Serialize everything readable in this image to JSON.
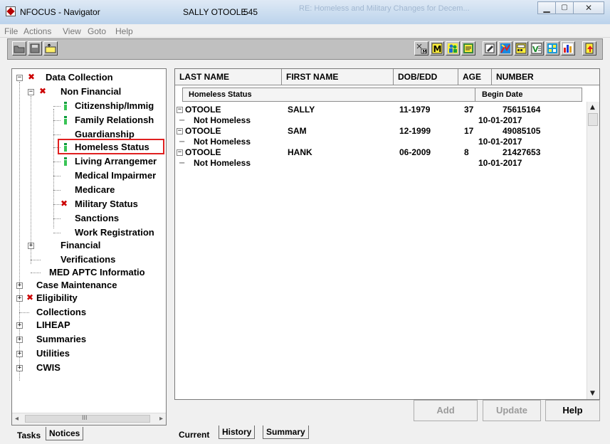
{
  "window": {
    "title": "NFOCUS - Navigator",
    "user": "SALLY OTOOLE",
    "case_number": "545",
    "faint_text": "RE: Homeless and Military Changes for Decem..."
  },
  "menu": [
    "File",
    "Actions",
    "View",
    "Goto",
    "Help"
  ],
  "toolbar": {
    "left_icons": [
      "open-folder-icon",
      "save-disk-icon",
      "new-folder-icon"
    ],
    "right_icons": [
      "case-tool-icon",
      "m-icon",
      "people-icon",
      "notes-icon",
      "edit-icon",
      "map-icon",
      "calculator-icon",
      "v-icon",
      "grid-icon",
      "bar-chart-icon",
      "exit-icon"
    ]
  },
  "tree": {
    "items": [
      {
        "label": "Data Collection",
        "level": 0,
        "expander": "minus",
        "marker": "red-x"
      },
      {
        "label": "Non Financial",
        "level": 1,
        "expander": "minus",
        "marker": "red-x"
      },
      {
        "label": "Citizenship/Immig",
        "level": 2,
        "marker": "green-i"
      },
      {
        "label": "Family Relationsh",
        "level": 2,
        "marker": "green-i"
      },
      {
        "label": "Guardianship",
        "level": 2,
        "marker": ""
      },
      {
        "label": "Homeless Status",
        "level": 2,
        "marker": "green-i",
        "selected": true
      },
      {
        "label": "Living Arrangemer",
        "level": 2,
        "marker": "green-i"
      },
      {
        "label": "Medical Impairmer",
        "level": 2,
        "marker": ""
      },
      {
        "label": "Medicare",
        "level": 2,
        "marker": ""
      },
      {
        "label": "Military Status",
        "level": 2,
        "marker": "red-x"
      },
      {
        "label": "Sanctions",
        "level": 2,
        "marker": ""
      },
      {
        "label": "Work Registration",
        "level": 2,
        "marker": ""
      },
      {
        "label": "Financial",
        "level": 1,
        "expander": "plus",
        "marker": ""
      },
      {
        "label": "Verifications",
        "level": 1,
        "marker": ""
      },
      {
        "label": "MED APTC Informatio",
        "level": 1,
        "marker": ""
      },
      {
        "label": "Case Maintenance",
        "level": 0,
        "expander": "plus",
        "marker": ""
      },
      {
        "label": "Eligibility",
        "level": 0,
        "expander": "plus",
        "marker": "red-x"
      },
      {
        "label": "Collections",
        "level": 0,
        "marker": ""
      },
      {
        "label": "LIHEAP",
        "level": 0,
        "expander": "plus",
        "marker": ""
      },
      {
        "label": "Summaries",
        "level": 0,
        "expander": "plus",
        "marker": ""
      },
      {
        "label": "Utilities",
        "level": 0,
        "expander": "plus",
        "marker": ""
      },
      {
        "label": "CWIS",
        "level": 0,
        "expander": "plus",
        "marker": ""
      }
    ],
    "scroll_thumb_label": "III"
  },
  "left_tabs": {
    "tasks": "Tasks",
    "notices": "Notices"
  },
  "grid": {
    "columns": [
      "LAST NAME",
      "FIRST NAME",
      "DOB/EDD",
      "AGE",
      "NUMBER"
    ],
    "sub_columns": [
      "Homeless Status",
      "Begin Date"
    ],
    "records": [
      {
        "last": "OTOOLE",
        "first": "SALLY",
        "dob": "11-1979",
        "age": "37",
        "number": "75615164",
        "status": "Not Homeless",
        "begin": "10-01-2017"
      },
      {
        "last": "OTOOLE",
        "first": "SAM",
        "dob": "12-1999",
        "age": "17",
        "number": "49085105",
        "status": "Not Homeless",
        "begin": "10-01-2017"
      },
      {
        "last": "OTOOLE",
        "first": "HANK",
        "dob": "06-2009",
        "age": "8",
        "number": "21427653",
        "status": "Not Homeless",
        "begin": "10-01-2017"
      }
    ]
  },
  "buttons": {
    "add": "Add",
    "update": "Update",
    "help": "Help"
  },
  "right_tabs": {
    "current": "Current",
    "history": "History",
    "summary": "Summary"
  }
}
